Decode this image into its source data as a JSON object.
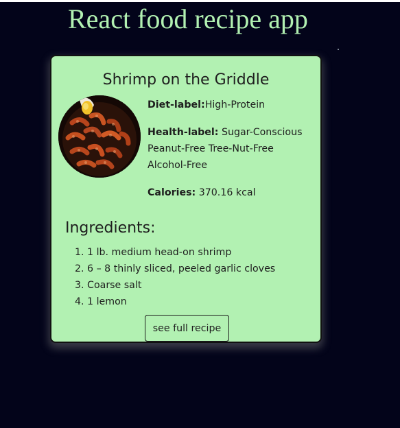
{
  "app": {
    "title": "React food recipe app"
  },
  "recipe": {
    "title": "Shrimp on the Griddle",
    "diet_label_key": "Diet-label:",
    "diet_label_value": "High-Protein",
    "health_label_key": "Health-label:",
    "health_label_value": " Sugar-Conscious Peanut-Free Tree-Nut-Free Alcohol-Free",
    "calories_key": "Calories:",
    "calories_value": " 370.16 kcal",
    "ingredients_heading": "Ingredients:",
    "ingredients": [
      "1 lb. medium head-on shrimp",
      "6 – 8 thinly sliced, peeled garlic cloves",
      "Coarse salt",
      "1 lemon"
    ],
    "full_recipe_button": "see full recipe"
  },
  "colors": {
    "page_background": "#03041a",
    "title_color": "#b2f1b2",
    "card_background": "#b2f1b2"
  },
  "icons": {
    "recipe_image": "shrimp-dish-photo"
  }
}
